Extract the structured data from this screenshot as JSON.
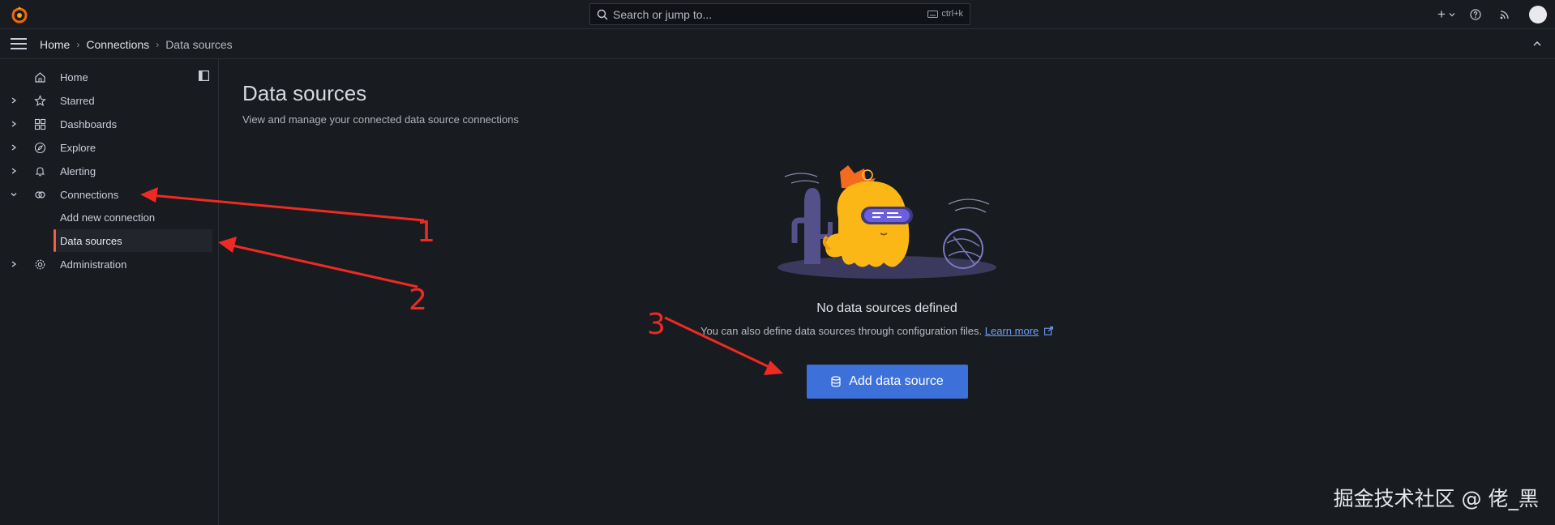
{
  "search": {
    "placeholder": "Search or jump to...",
    "shortcut": "ctrl+k"
  },
  "topbar": {
    "new_label": "+"
  },
  "breadcrumb": {
    "items": [
      "Home",
      "Connections"
    ],
    "current": "Data sources",
    "separator": "›"
  },
  "sidebar": {
    "items": [
      {
        "label": "Home",
        "icon": "home-icon",
        "expandable": false
      },
      {
        "label": "Starred",
        "icon": "star-icon",
        "expandable": true
      },
      {
        "label": "Dashboards",
        "icon": "grid-icon",
        "expandable": true
      },
      {
        "label": "Explore",
        "icon": "compass-icon",
        "expandable": true
      },
      {
        "label": "Alerting",
        "icon": "bell-icon",
        "expandable": true
      },
      {
        "label": "Connections",
        "icon": "connections-icon",
        "expandable": true,
        "expanded": true,
        "children": [
          {
            "label": "Add new connection"
          },
          {
            "label": "Data sources",
            "active": true
          }
        ]
      },
      {
        "label": "Administration",
        "icon": "cog-icon",
        "expandable": true
      }
    ]
  },
  "main": {
    "title": "Data sources",
    "subtitle": "View and manage your connected data source connections",
    "empty": {
      "title": "No data sources defined",
      "text": "You can also define data sources through configuration files.",
      "link": "Learn more",
      "button": "Add data source"
    }
  },
  "annotations": {
    "numbers": [
      "1",
      "2",
      "3"
    ],
    "color": "#ee2a24"
  },
  "watermark": "掘金技术社区 @ 佬_黑",
  "colors": {
    "background": "#181b1f",
    "accent": "#f55f3e",
    "primary": "#3d71d9",
    "link": "#6e9fff"
  }
}
